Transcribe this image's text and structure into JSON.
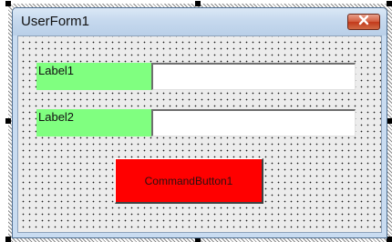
{
  "form": {
    "title": "UserForm1",
    "close_icon": "close-x-icon",
    "accent_colors": {
      "label_background": "#80ff80",
      "button_background": "#ff0000",
      "close_button": "#d35d3f"
    }
  },
  "controls": {
    "label1": "Label1",
    "label2": "Label2",
    "textbox1_value": "",
    "textbox2_value": "",
    "command_button": "CommandButton1"
  }
}
